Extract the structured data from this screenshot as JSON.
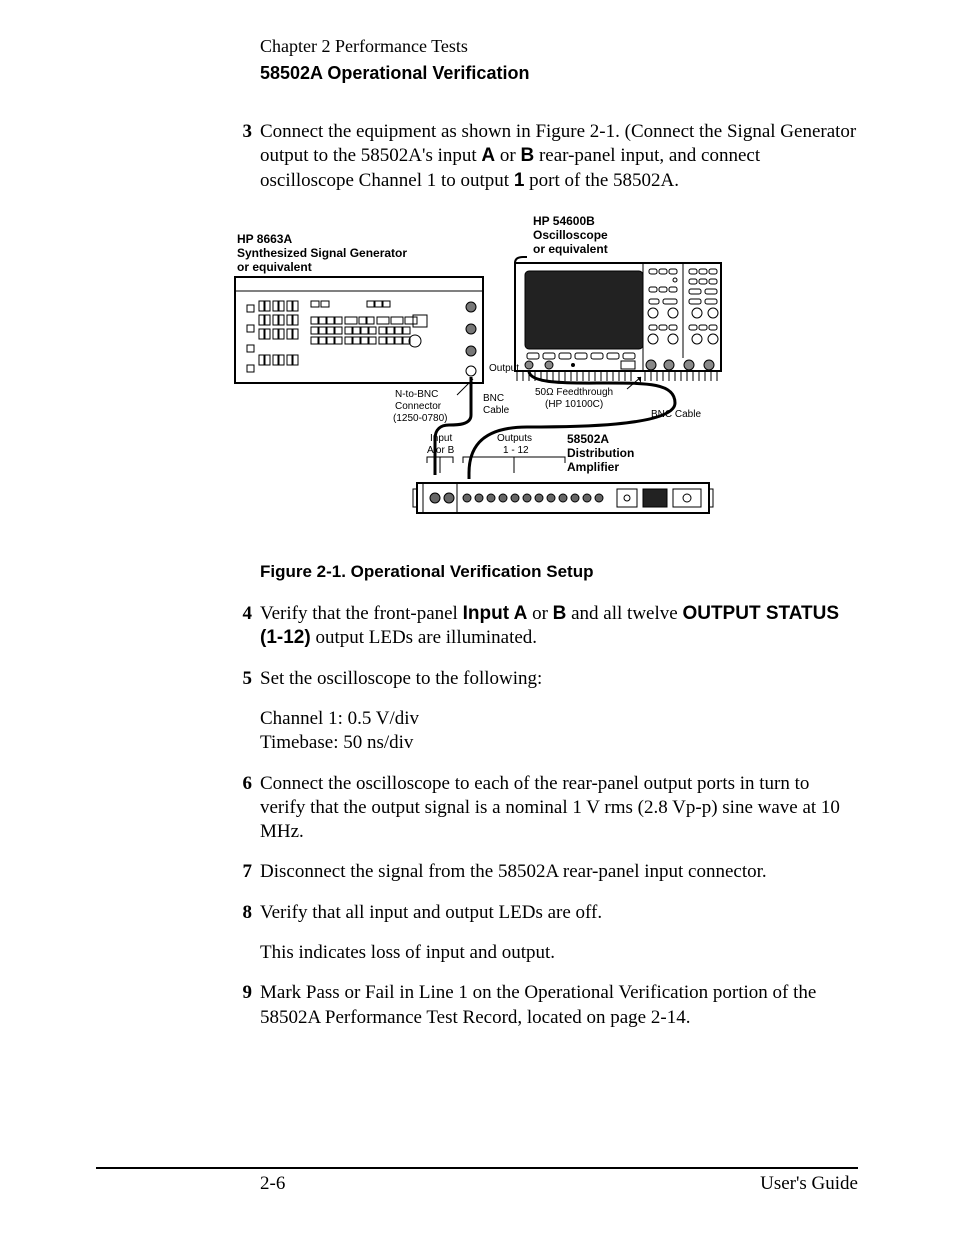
{
  "header": {
    "chapter": "Chapter 2  Performance Tests",
    "section": "58502A Operational Verification"
  },
  "steps": {
    "s3": {
      "num": "3",
      "pre": "Connect the equipment as shown in Figure 2-1. (Connect the Signal Generator output to the 58502A's input ",
      "bold1": "A",
      "mid1": " or ",
      "bold2": "B",
      "mid2": " rear-panel input, and connect oscilloscope Channel 1 to output ",
      "bold3": "1",
      "post": " port of the 58502A."
    },
    "s4": {
      "num": "4",
      "pre": "Verify that the front-panel ",
      "bold1": "Input A",
      "mid1": " or ",
      "bold2": "B",
      "mid2": " and all twelve ",
      "bold3": "OUTPUT STATUS (1-12)",
      "post": " output LEDs are illuminated."
    },
    "s5": {
      "num": "5",
      "txt": "Set the oscilloscope to the following:",
      "sub1": "Channel 1: 0.5 V/div",
      "sub2": "Timebase: 50 ns/div"
    },
    "s6": {
      "num": "6",
      "txt": "Connect the oscilloscope to each of the rear-panel output ports in turn to verify that the output signal is a nominal 1 V rms (2.8 Vp-p) sine wave at 10 MHz."
    },
    "s7": {
      "num": "7",
      "txt": "Disconnect the signal from the 58502A rear-panel input connector."
    },
    "s8": {
      "num": "8",
      "txt": "Verify that all input and output LEDs are off.",
      "sub1": " This indicates loss of input and output."
    },
    "s9": {
      "num": "9",
      "txt": "Mark Pass or Fail in Line 1 on the Operational Verification portion of the 58502A Performance Test Record, located on page 2-14."
    }
  },
  "figure": {
    "caption": "Figure 2-1. Operational Verification Setup",
    "sigGenTitle1": "HP 8663A",
    "sigGenTitle2": "Synthesized Signal Generator",
    "sigGenTitle3": "or equivalent",
    "scopeTitle1": "HP 54600B",
    "scopeTitle2": "Oscilloscope",
    "scopeTitle3": "or equivalent",
    "ntobnc1": "N-to-BNC",
    "ntobnc2": "Connector",
    "ntobnc3": "(1250-0780)",
    "output": "Output",
    "bnc1": "BNC",
    "bnc2": "Cable",
    "feed1": "50Ω Feedthrough",
    "feed2": "(HP 10100C)",
    "bncCable": "BNC Cable",
    "inputA": "Input",
    "inputB": "A or B",
    "outputs1": "Outputs",
    "outputs2": "1 - 12",
    "amp1": "58502A",
    "amp2": "Distribution",
    "amp3": "Amplifier"
  },
  "footer": {
    "pageNum": "2-6",
    "guide": "User's Guide"
  }
}
